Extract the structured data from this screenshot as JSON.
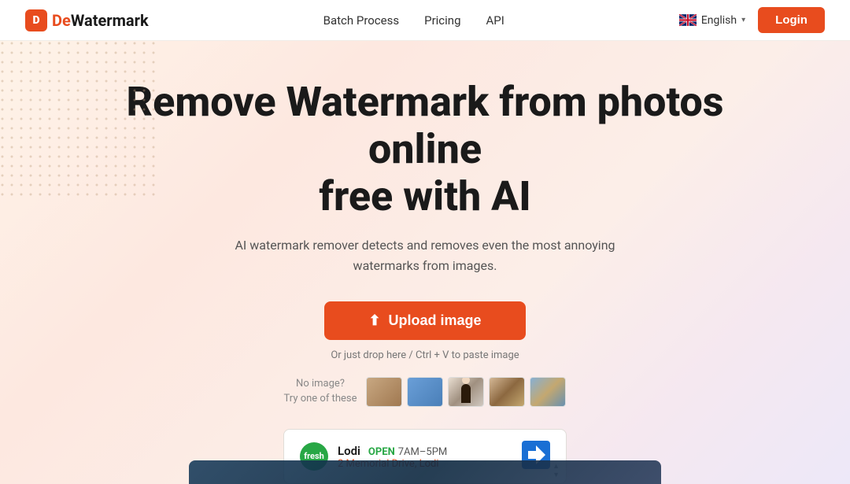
{
  "navbar": {
    "logo_icon": "D",
    "logo_de": "De",
    "logo_wm": "Watermark",
    "nav_batch": "Batch Process",
    "nav_pricing": "Pricing",
    "nav_api": "API",
    "lang_label": "English",
    "lang_flag_alt": "UK flag",
    "login_label": "Login"
  },
  "hero": {
    "title_line1": "Remove Watermark from photos online",
    "title_line2": "free with AI",
    "subtitle": "AI watermark remover detects and removes even the most annoying watermarks from images.",
    "upload_btn": "Upload image",
    "drop_hint": "Or just drop here / Ctrl + V to paste image",
    "sample_label_line1": "No image?",
    "sample_label_line2": "Try one of these",
    "sample_thumbs": [
      {
        "id": "thumb-1",
        "alt": "Sample image 1"
      },
      {
        "id": "thumb-2",
        "alt": "Sample image 2"
      },
      {
        "id": "thumb-3",
        "alt": "Sample image 3"
      },
      {
        "id": "thumb-4",
        "alt": "Sample image 4"
      },
      {
        "id": "thumb-5",
        "alt": "Sample image 5"
      }
    ]
  },
  "ad": {
    "logo_text": "fresh",
    "business_name": "Lodi",
    "status": "OPEN",
    "hours": "7AM–5PM",
    "address": "2 Memorial Drive, Lodi",
    "arrow_label": "directions",
    "control_up": "▲",
    "control_down": "▼"
  },
  "colors": {
    "brand_orange": "#e84c1e",
    "brand_green": "#28a745",
    "brand_blue": "#1a6fd4",
    "text_dark": "#1a1a1a",
    "text_mid": "#555",
    "text_light": "#888"
  }
}
